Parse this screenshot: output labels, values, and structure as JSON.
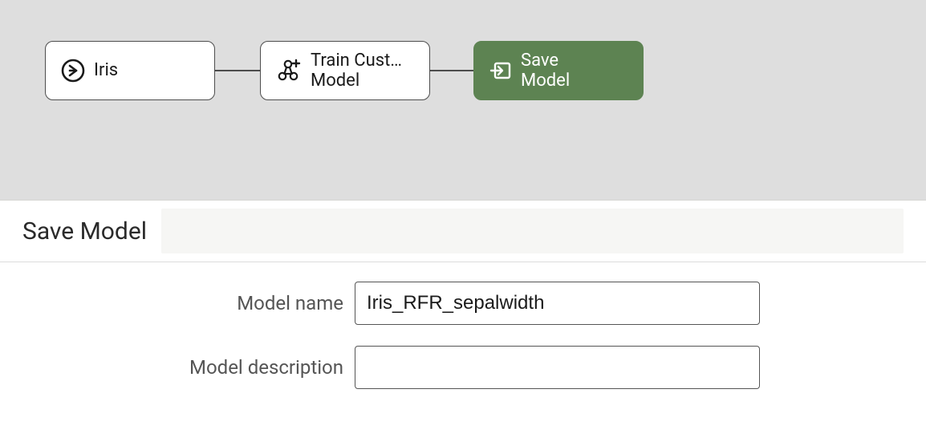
{
  "colors": {
    "canvas_bg": "#dedede",
    "node_stroke": "#4d4d4d",
    "selected_bg": "#5d8352"
  },
  "pipeline": {
    "nodes": [
      {
        "id": "iris",
        "label": "Iris",
        "type": "source",
        "selected": false
      },
      {
        "id": "train",
        "label": "Train Cust…\nModel",
        "type": "train",
        "selected": false
      },
      {
        "id": "save",
        "label": "Save\nModel",
        "type": "save",
        "selected": true
      }
    ]
  },
  "panel": {
    "title": "Save Model",
    "form": {
      "model_name_label": "Model name",
      "model_name_value": "Iris_RFR_sepalwidth",
      "model_desc_label": "Model description",
      "model_desc_value": ""
    }
  }
}
